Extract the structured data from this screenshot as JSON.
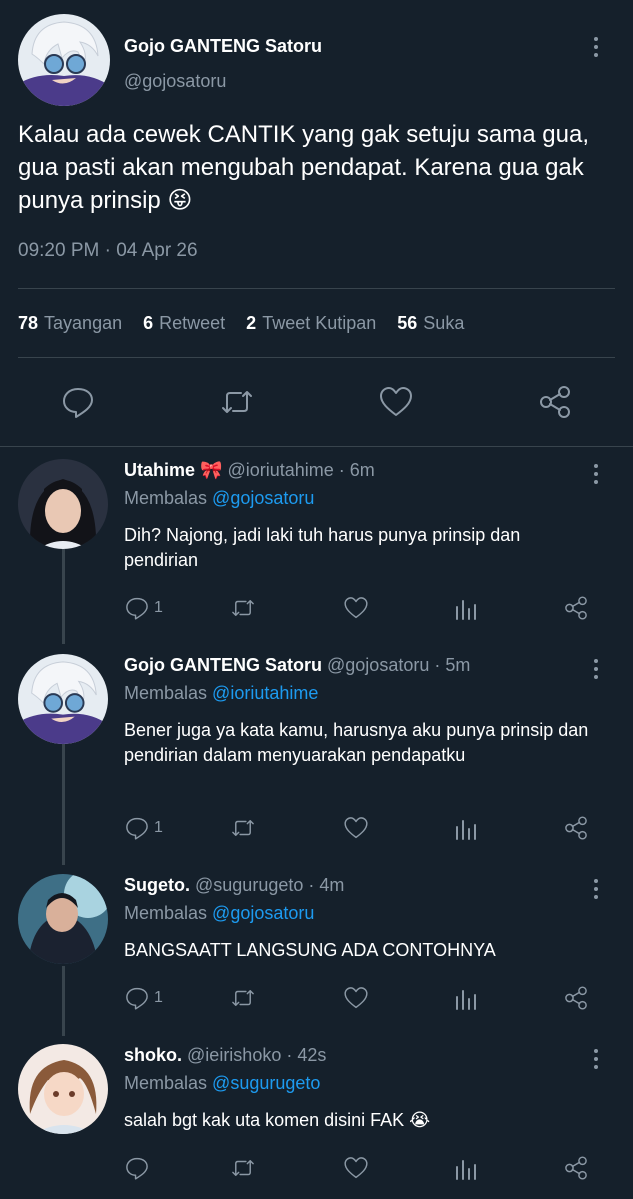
{
  "main_tweet": {
    "author_name": "Gojo GANTENG Satoru",
    "author_handle": "@gojosatoru",
    "text": "Kalau ada cewek CANTIK yang gak setuju sama gua, gua pasti akan mengubah pendapat. Karena gua gak punya prinsip 😝",
    "timestamp": "09:20 PM · 04 Apr 26",
    "stats": [
      {
        "count": "78",
        "label": "Tayangan"
      },
      {
        "count": "6",
        "label": "Retweet"
      },
      {
        "count": "2",
        "label": "Tweet Kutipan"
      },
      {
        "count": "56",
        "label": "Suka"
      }
    ]
  },
  "replies": [
    {
      "name": "Utahime 🎀",
      "handle": "@ioriutahime",
      "time": "· 6m",
      "replying_label": "Membalas",
      "replying_to": "@gojosatoru",
      "text": "Dih? Najong, jadi laki tuh harus punya prinsip dan pendirian",
      "reply_count": "1"
    },
    {
      "name": "Gojo GANTENG Satoru",
      "handle": "@gojosatoru",
      "time": "· 5m",
      "replying_label": "Membalas",
      "replying_to": "@ioriutahime",
      "text": "Bener juga ya kata kamu, harusnya aku punya prinsip dan pendirian dalam menyuarakan pendapatku",
      "reply_count": "1"
    },
    {
      "name": "Sugeto.",
      "handle": "@sugurugeto",
      "time": "· 4m",
      "replying_label": "Membalas",
      "replying_to": "@gojosatoru",
      "text": "BANGSAATT LANGSUNG ADA CONTOHNYA",
      "reply_count": "1"
    },
    {
      "name": "shoko.",
      "handle": "@ieirishoko",
      "time": "· 42s",
      "replying_label": "Membalas",
      "replying_to": "@sugurugeto",
      "text": "salah bgt kak uta komen disini FAK 😭",
      "reply_count": ""
    }
  ],
  "icons": {
    "reply": "reply-icon",
    "retweet": "retweet-icon",
    "like": "heart-icon",
    "share": "share-icon",
    "views": "views-icon",
    "more": "more-vertical-icon"
  },
  "colors": {
    "background": "#15202b",
    "link": "#1d9bf0",
    "muted": "#8b98a5",
    "divider": "#38444d"
  }
}
